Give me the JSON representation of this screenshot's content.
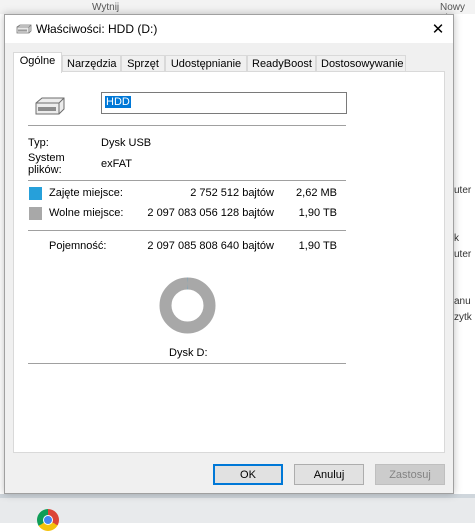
{
  "background": {
    "top_fragment": "Wytnij",
    "right_top_fragment": "Nowy el",
    "right_fragments": [
      "uter",
      "k",
      "uter",
      "anu",
      "zytk"
    ]
  },
  "window": {
    "title": "Właściwości: HDD (D:)",
    "close_glyph": "✕"
  },
  "tabs": [
    {
      "label": "Ogólne",
      "active": true
    },
    {
      "label": "Narzędzia",
      "active": false
    },
    {
      "label": "Sprzęt",
      "active": false
    },
    {
      "label": "Udostępnianie",
      "active": false
    },
    {
      "label": "ReadyBoost",
      "active": false
    },
    {
      "label": "Dostosowywanie",
      "active": false
    }
  ],
  "general": {
    "volume_name": "HDD",
    "type_label": "Typ:",
    "type_value": "Dysk USB",
    "fs_label_line1": "System",
    "fs_label_line2": "plików:",
    "fs_value": "exFAT",
    "used_label": "Zajęte miejsce:",
    "used_bytes": "2 752 512 bajtów",
    "used_short": "2,62 MB",
    "free_label": "Wolne miejsce:",
    "free_bytes": "2 097 083 056 128 bajtów",
    "free_short": "1,90 TB",
    "capacity_label": "Pojemność:",
    "capacity_bytes": "2 097 085 808 640 bajtów",
    "capacity_short": "1,90 TB",
    "disk_label": "Dysk D:",
    "used_fraction": 1.3e-06
  },
  "colors": {
    "used": "#26a0da",
    "free": "#a8a8a8",
    "accent": "#0078d7"
  },
  "buttons": {
    "ok": "OK",
    "cancel": "Anuluj",
    "apply": "Zastosuj"
  },
  "icons": {
    "title": "drive-icon",
    "drive": "drive-icon",
    "close": "close-icon",
    "taskbar_app": "chrome-icon"
  }
}
